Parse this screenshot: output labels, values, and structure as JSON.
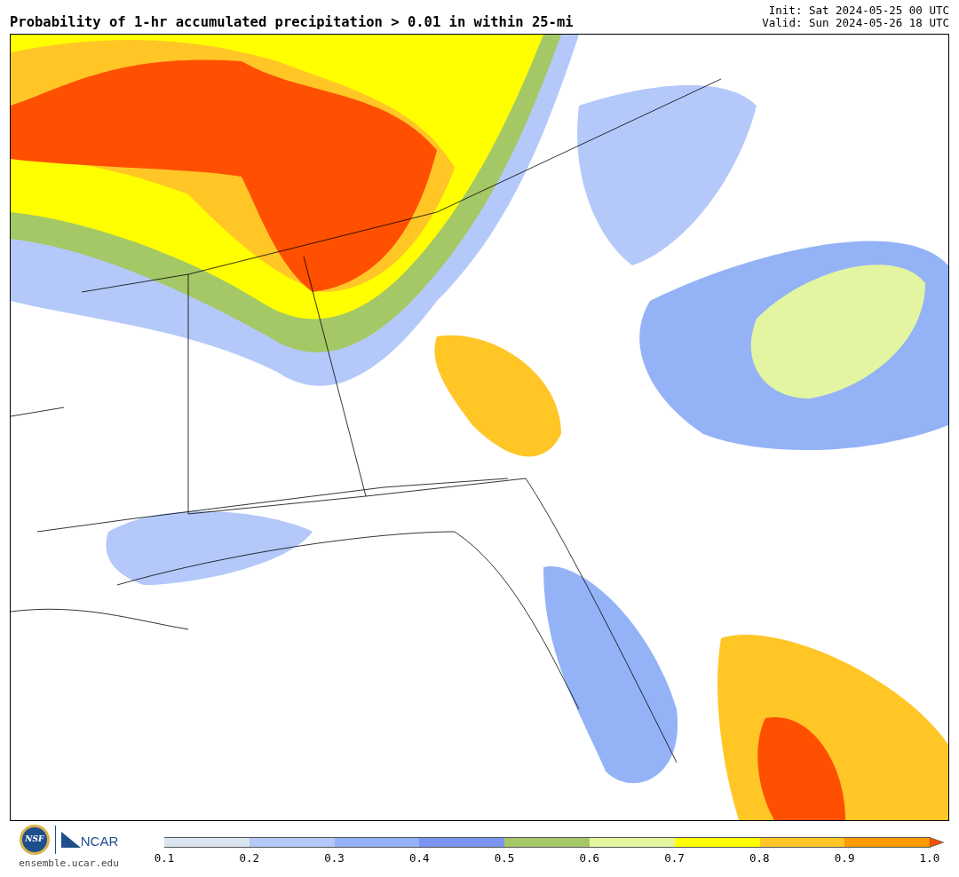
{
  "title": "Probability of 1-hr accumulated precipitation > 0.01 in within 25-mi",
  "init": "Init: Sat 2024-05-25 00 UTC",
  "valid": "Valid: Sun 2024-05-26 18 UTC",
  "logos": {
    "nsf": "NSF",
    "ncar": "NCAR",
    "website": "ensemble.ucar.edu"
  },
  "legend": {
    "bins": [
      {
        "color": "#dae5ef"
      },
      {
        "color": "#b4c9fa"
      },
      {
        "color": "#94b3f7"
      },
      {
        "color": "#7a95f2"
      },
      {
        "color": "#a5c866"
      },
      {
        "color": "#e4f5a2"
      },
      {
        "color": "#ffff00"
      },
      {
        "color": "#ffc626"
      },
      {
        "color": "#ff9a00"
      }
    ],
    "over": {
      "color": "#ff4f00"
    },
    "ticks": [
      "0.1",
      "0.2",
      "0.3",
      "0.4",
      "0.5",
      "0.6",
      "0.7",
      "0.8",
      "0.9",
      "1.0"
    ]
  }
}
